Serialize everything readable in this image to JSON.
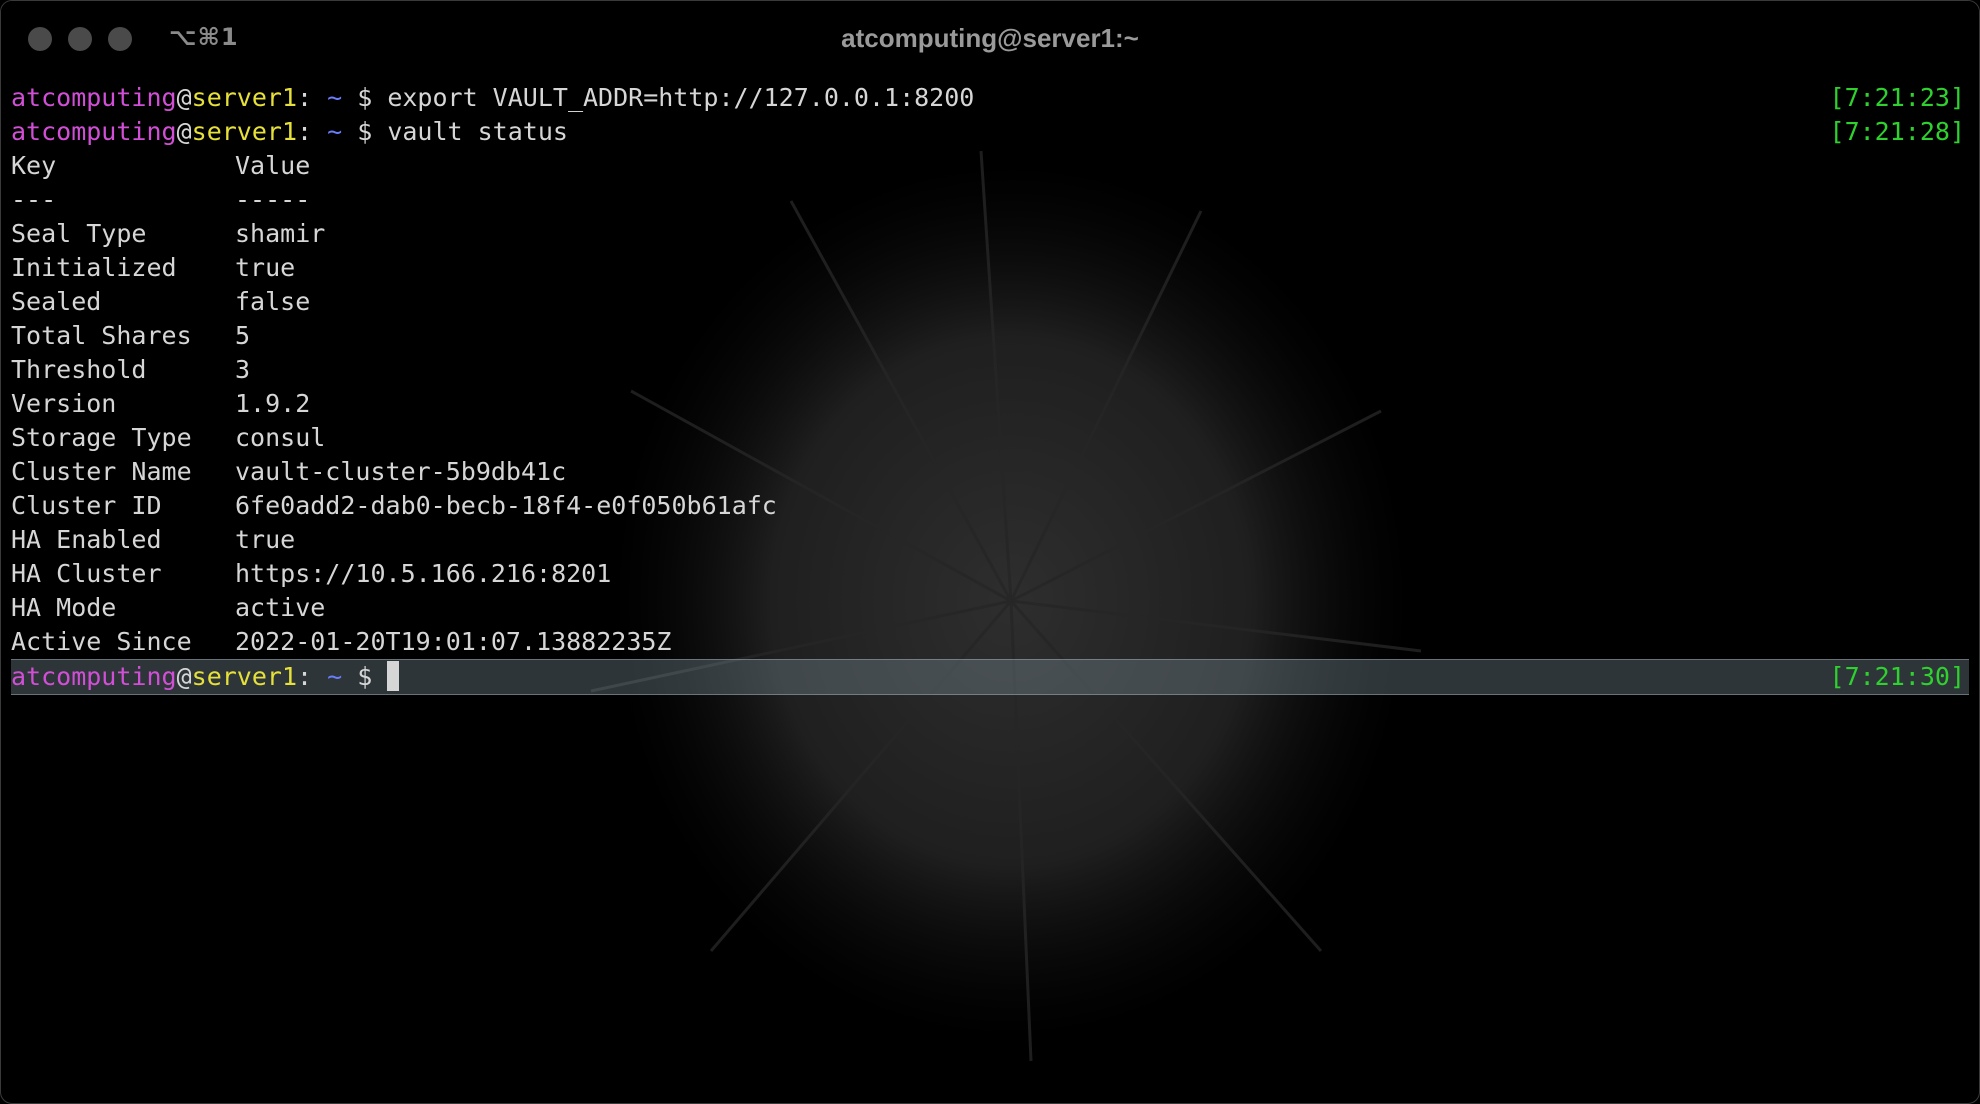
{
  "window": {
    "shortcut": "⌥⌘1",
    "title": "atcomputing@server1:~"
  },
  "prompt": {
    "user": "atcomputing",
    "at": "@",
    "host": "server1",
    "sep": ": ",
    "dir": "~",
    "symbol": " $ "
  },
  "commands": [
    {
      "text": "export VAULT_ADDR=http://127.0.0.1:8200",
      "time": "[7:21:23]"
    },
    {
      "text": "vault status",
      "time": "[7:21:28]"
    }
  ],
  "status_table": {
    "header": {
      "key": "Key",
      "value": "Value"
    },
    "divider": {
      "key": "---",
      "value": "-----"
    },
    "rows": [
      {
        "key": "Seal Type",
        "value": "shamir"
      },
      {
        "key": "Initialized",
        "value": "true"
      },
      {
        "key": "Sealed",
        "value": "false"
      },
      {
        "key": "Total Shares",
        "value": "5"
      },
      {
        "key": "Threshold",
        "value": "3"
      },
      {
        "key": "Version",
        "value": "1.9.2"
      },
      {
        "key": "Storage Type",
        "value": "consul"
      },
      {
        "key": "Cluster Name",
        "value": "vault-cluster-5b9db41c"
      },
      {
        "key": "Cluster ID",
        "value": "6fe0add2-dab0-becb-18f4-e0f050b61afc"
      },
      {
        "key": "HA Enabled",
        "value": "true"
      },
      {
        "key": "HA Cluster",
        "value": "https://10.5.166.216:8201"
      },
      {
        "key": "HA Mode",
        "value": "active"
      },
      {
        "key": "Active Since",
        "value": "2022-01-20T19:01:07.13882235Z"
      }
    ]
  },
  "current_prompt": {
    "time": "[7:21:30]"
  },
  "colors": {
    "user": "#d14fd6",
    "host": "#e6e03a",
    "dir": "#6a7dff",
    "timestamp": "#2fd12f",
    "text": "#d6d6d6"
  }
}
